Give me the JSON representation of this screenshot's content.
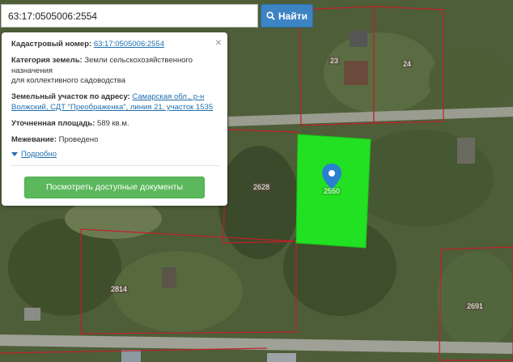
{
  "search": {
    "value": "63:17:0505006:2554"
  },
  "find_button": {
    "label": "Найти",
    "icon": "search-icon"
  },
  "popup": {
    "cadastral_label": "Кадастровый номер:",
    "cadastral_value": "63:17:0505006:2554",
    "category_label": "Категория земель:",
    "category_value_1": "Земли сельскохозяйственного",
    "category_value_2": "назначения",
    "category_value_3": "для коллективного садоводства",
    "address_label": "Земельный участок по адресу:",
    "address_value_1": "Самарская обл., р-н",
    "address_value_2": "Волжский, СДТ \"Преображенка\", линия 21, участок 1535",
    "area_label": "Уточненная площадь:",
    "area_value": "589 кв.м.",
    "survey_label": "Межевание:",
    "survey_value": "Проведено",
    "details_link": "Подробно",
    "docs_button": "Посмотреть доступные документы",
    "close_symbol": "×"
  },
  "map": {
    "parcel_labels": [
      "23",
      "24",
      "2628",
      "2550",
      "2814",
      "2691"
    ],
    "colors": {
      "selected_parcel": "#22e022",
      "boundary": "#c0202a",
      "marker": "#2a7fd0"
    }
  }
}
